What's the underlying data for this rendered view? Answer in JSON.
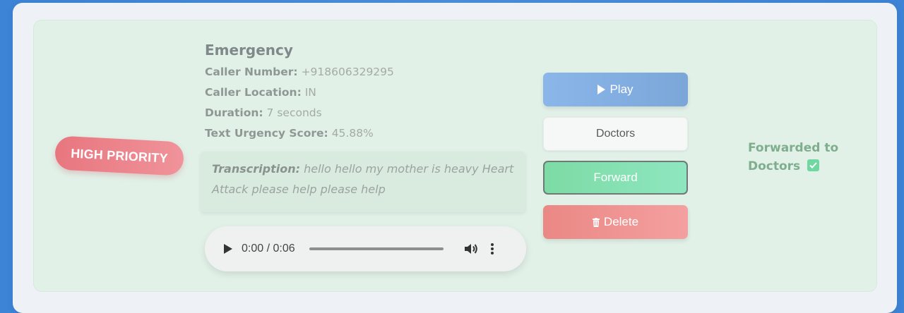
{
  "call": {
    "priority_label": "HIGH PRIORITY",
    "category": "Emergency",
    "caller_number_label": "Caller Number:",
    "caller_number": "+918606329295",
    "caller_location_label": "Caller Location:",
    "caller_location": "IN",
    "duration_label": "Duration:",
    "duration": "7 seconds",
    "urgency_label": "Text Urgency Score:",
    "urgency": "45.88%",
    "transcription_label": "Transcription:",
    "transcription": "hello hello my mother is heavy Heart Attack please help please help"
  },
  "audio": {
    "time_display": "0:00 / 0:06",
    "progress": 0
  },
  "actions": {
    "play_label": "Play",
    "department_selected": "Doctors",
    "forward_label": "Forward",
    "delete_label": "Delete"
  },
  "status": {
    "text": "Forwarded to Doctors"
  },
  "icons": {
    "play": "play-icon",
    "volume": "volume-icon",
    "more": "more-vertical-icon",
    "trash": "trash-icon",
    "check": "checkbox-checked-icon"
  },
  "colors": {
    "priority_high": "#e8767f",
    "card_bg": "#e1f1e8",
    "play_button": "#8bb6ea",
    "forward_button": "#7ddba4",
    "delete_button": "#ea8884",
    "status_text": "#7fae8e"
  }
}
